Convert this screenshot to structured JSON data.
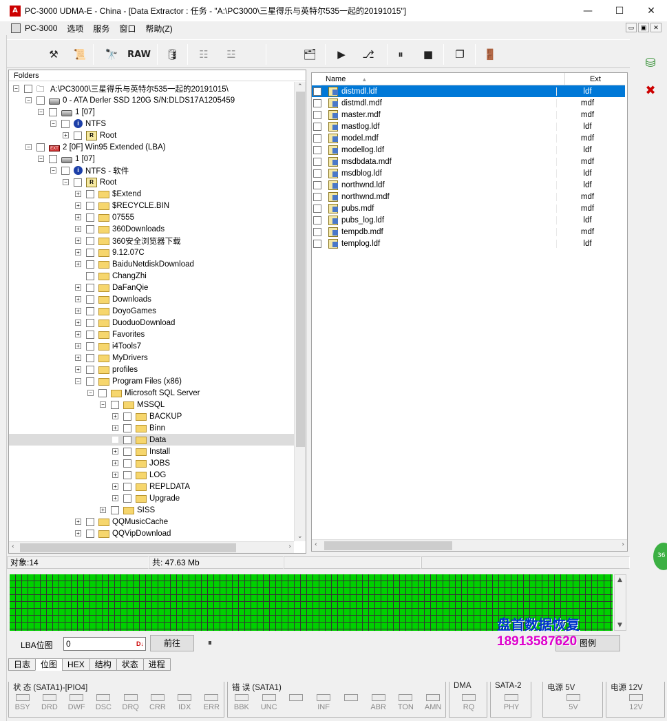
{
  "window": {
    "title": "PC-3000 UDMA-E - China - [Data Extractor : 任务 - \"A:\\PC3000\\三星得乐与英特尔535一起的20191015\"]",
    "icon_text": "A",
    "minimize": "—",
    "maximize": "☐",
    "close": "✕"
  },
  "menu": {
    "items": [
      "PC-3000",
      "选项",
      "服务",
      "窗口",
      "帮助(Z)"
    ]
  },
  "mdi": {
    "minimize": "▭",
    "restore": "▣",
    "close": "✕"
  },
  "toolbar": {
    "raw_label": "RAW"
  },
  "tree": {
    "header": "Folders",
    "rows": [
      {
        "label": "A:\\PC3000\\三星得乐与英特尔535一起的20191015\\",
        "icon": "task-icon",
        "exp": "-"
      },
      {
        "label": "0 - ATA Derler SSD 120G  S/N:DLDS17A1205459",
        "icon": "drive-icon",
        "exp": "-"
      },
      {
        "label": "1 [07]",
        "icon": "partition-icon",
        "exp": "-"
      },
      {
        "label": "NTFS",
        "icon": "info-icon",
        "exp": "-"
      },
      {
        "label": "Root",
        "icon": "root-icon",
        "exp": "+"
      },
      {
        "label": "2 [0F] Win95 Extended  (LBA)",
        "icon": "extended-partition-icon",
        "exp": "-"
      },
      {
        "label": "1 [07]",
        "icon": "partition-icon",
        "exp": "-"
      },
      {
        "label": "NTFS - 软件",
        "icon": "info-icon",
        "exp": "-"
      },
      {
        "label": "Root",
        "icon": "root-icon",
        "exp": "-"
      },
      {
        "label": "$Extend",
        "icon": "folder-icon",
        "exp": "+"
      },
      {
        "label": "$RECYCLE.BIN",
        "icon": "folder-icon",
        "exp": "+"
      },
      {
        "label": "07555",
        "icon": "folder-icon",
        "exp": "+"
      },
      {
        "label": "360Downloads",
        "icon": "folder-icon",
        "exp": "+"
      },
      {
        "label": "360安全浏览器下载",
        "icon": "folder-icon",
        "exp": "+"
      },
      {
        "label": "9.12.07C",
        "icon": "folder-icon",
        "exp": "+"
      },
      {
        "label": "BaiduNetdiskDownload",
        "icon": "folder-icon",
        "exp": "+"
      },
      {
        "label": "ChangZhi",
        "icon": "folder-icon",
        "exp": ""
      },
      {
        "label": "DaFanQie",
        "icon": "folder-icon",
        "exp": "+"
      },
      {
        "label": "Downloads",
        "icon": "folder-icon",
        "exp": "+"
      },
      {
        "label": "DoyoGames",
        "icon": "folder-icon",
        "exp": "+"
      },
      {
        "label": "DuoduoDownload",
        "icon": "folder-icon",
        "exp": "+"
      },
      {
        "label": "Favorites",
        "icon": "folder-icon",
        "exp": "+"
      },
      {
        "label": "i4Tools7",
        "icon": "folder-icon",
        "exp": "+"
      },
      {
        "label": "MyDrivers",
        "icon": "folder-icon",
        "exp": "+"
      },
      {
        "label": "profiles",
        "icon": "folder-icon",
        "exp": "+"
      },
      {
        "label": "Program Files (x86)",
        "icon": "folder-icon",
        "exp": "-"
      },
      {
        "label": "Microsoft SQL Server",
        "icon": "folder-icon",
        "exp": "-"
      },
      {
        "label": "MSSQL",
        "icon": "folder-icon",
        "exp": "-"
      },
      {
        "label": "BACKUP",
        "icon": "folder-icon",
        "exp": "+"
      },
      {
        "label": "Binn",
        "icon": "folder-icon",
        "exp": "+"
      },
      {
        "label": "Data",
        "icon": "folder-icon",
        "exp": ""
      },
      {
        "label": "Install",
        "icon": "folder-icon",
        "exp": "+"
      },
      {
        "label": "JOBS",
        "icon": "folder-icon",
        "exp": "+"
      },
      {
        "label": "LOG",
        "icon": "folder-icon",
        "exp": "+"
      },
      {
        "label": "REPLDATA",
        "icon": "folder-icon",
        "exp": "+"
      },
      {
        "label": "Upgrade",
        "icon": "folder-icon",
        "exp": "+"
      },
      {
        "label": "SISS",
        "icon": "folder-icon",
        "exp": "+"
      },
      {
        "label": "QQMusicCache",
        "icon": "folder-icon",
        "exp": "+"
      },
      {
        "label": "QQVipDownload",
        "icon": "folder-icon",
        "exp": "+"
      }
    ]
  },
  "files": {
    "columns": [
      "Name",
      "Ext"
    ],
    "rows": [
      {
        "name": "distmdl.ldf",
        "ext": "ldf",
        "selected": true
      },
      {
        "name": "distmdl.mdf",
        "ext": "mdf"
      },
      {
        "name": "master.mdf",
        "ext": "mdf"
      },
      {
        "name": "mastlog.ldf",
        "ext": "ldf"
      },
      {
        "name": "model.mdf",
        "ext": "mdf"
      },
      {
        "name": "modellog.ldf",
        "ext": "ldf"
      },
      {
        "name": "msdbdata.mdf",
        "ext": "mdf"
      },
      {
        "name": "msdblog.ldf",
        "ext": "ldf"
      },
      {
        "name": "northwnd.ldf",
        "ext": "ldf"
      },
      {
        "name": "northwnd.mdf",
        "ext": "mdf"
      },
      {
        "name": "pubs.mdf",
        "ext": "mdf"
      },
      {
        "name": "pubs_log.ldf",
        "ext": "ldf"
      },
      {
        "name": "tempdb.mdf",
        "ext": "mdf"
      },
      {
        "name": "templog.ldf",
        "ext": "ldf"
      }
    ]
  },
  "status": {
    "objects": "对象:14",
    "total": "共:  47.63 Mb"
  },
  "lba": {
    "label": "LBA位图",
    "value": "0",
    "go_button": "前往",
    "pause": "⏸",
    "legend_button": "图例"
  },
  "tabs": [
    "日志",
    "位图",
    "HEX",
    "结构",
    "状态",
    "进程"
  ],
  "active_tab": "位图",
  "watermark": {
    "line1": "盘首数据恢复",
    "line2": "18913587620"
  },
  "green_badge": "36",
  "leds": [
    {
      "title": "状 态 (SATA1)-[PIO4]",
      "labels": [
        "BSY",
        "DRD",
        "DWF",
        "DSC",
        "DRQ",
        "CRR",
        "IDX",
        "ERR"
      ]
    },
    {
      "title": "错 误 (SATA1)",
      "labels": [
        "BBK",
        "UNC",
        "",
        "INF",
        "",
        "ABR",
        "TON",
        "AMN"
      ]
    },
    {
      "title": "DMA",
      "labels": [
        "RQ"
      ]
    },
    {
      "title": "SATA-2",
      "labels": [
        "PHY"
      ]
    },
    {
      "title": "电源 5V",
      "labels": [
        "5V"
      ]
    },
    {
      "title": "电源 12V",
      "labels": [
        "12V"
      ]
    }
  ],
  "colors": {
    "selection": "#0078d7",
    "bitmap_green": "#00d000",
    "watermark_blue": "#0033cc",
    "watermark_magenta": "#dd00cc"
  }
}
